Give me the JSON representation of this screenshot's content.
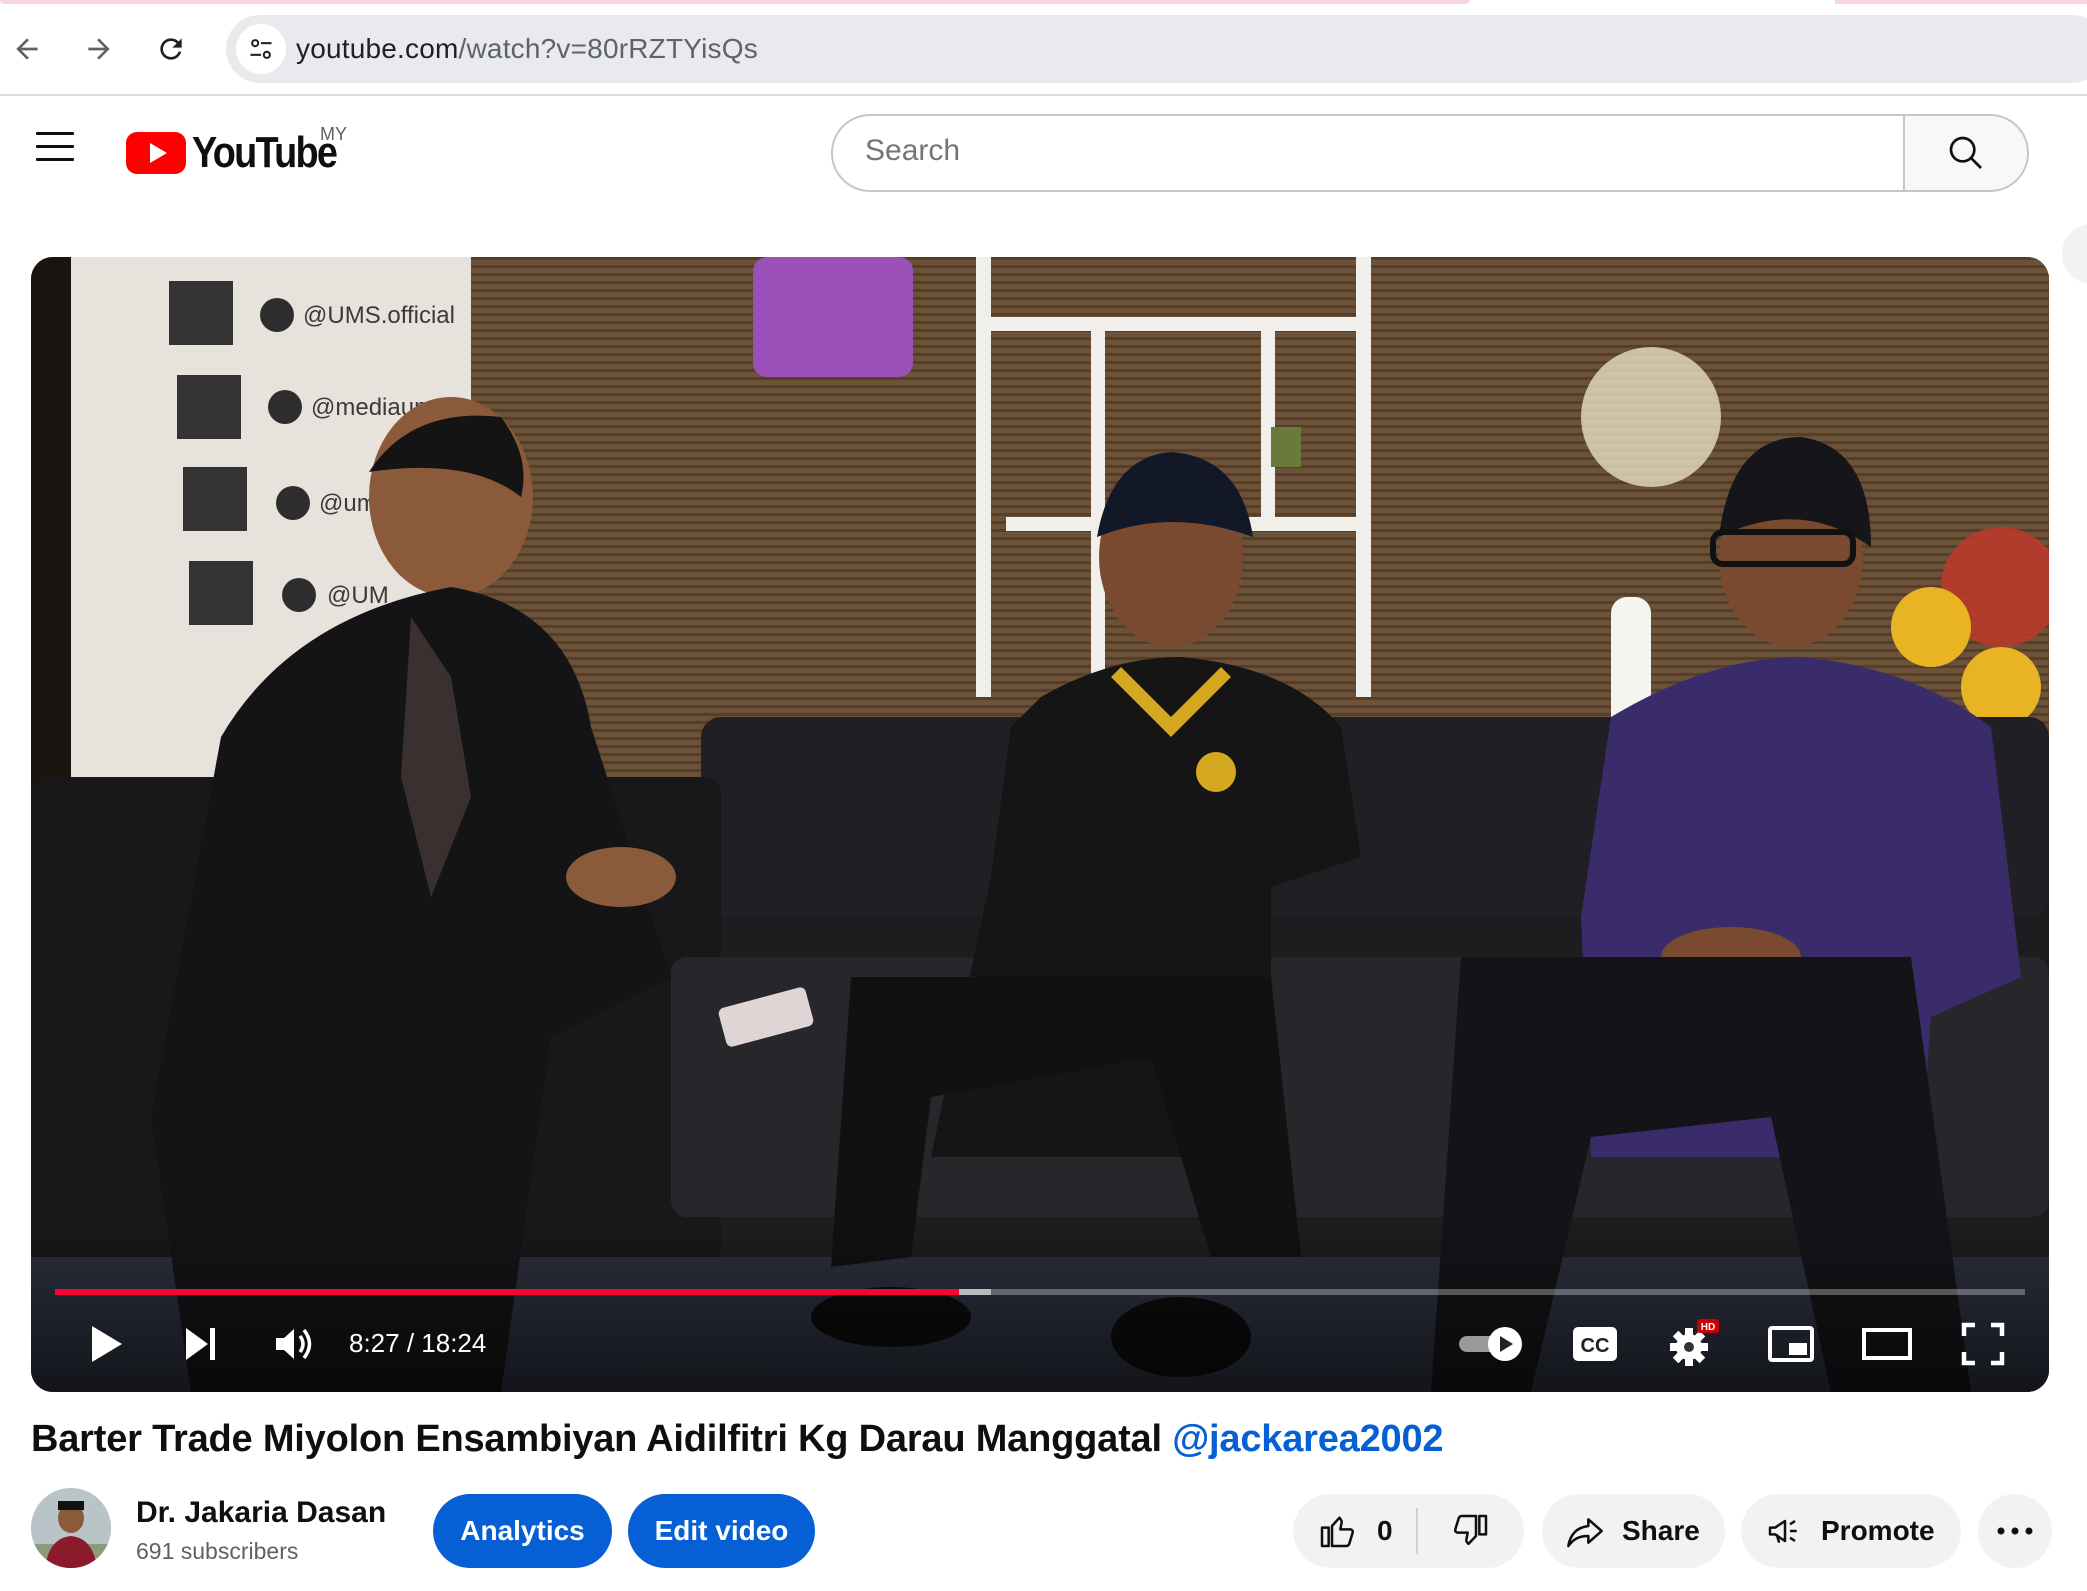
{
  "browser": {
    "url_host": "youtube.com",
    "url_path": "/watch?v=80rRZTYisQs"
  },
  "header": {
    "logo_text": "YouTube",
    "country_code": "MY",
    "search_placeholder": "Search"
  },
  "player": {
    "current_time": "8:27",
    "duration": "18:24",
    "time_display": "8:27 / 18:24",
    "progress_fraction": 0.459,
    "buffered_fraction": 0.475,
    "hd_badge": "HD",
    "cc_label": "CC",
    "scene_text": {
      "social_1": "@UMS.official",
      "social_2": "@mediaums",
      "social_3": "@umsc",
      "social_4": "@UM"
    }
  },
  "video": {
    "title": "Barter Trade Miyolon Ensambiyan Aidilfitri Kg Darau Manggatal ",
    "title_mention": "@jackarea2002"
  },
  "channel": {
    "name": "Dr. Jakaria Dasan",
    "subscribers": "691 subscribers"
  },
  "actions": {
    "analytics_label": "Analytics",
    "edit_label": "Edit video",
    "like_count": "0",
    "share_label": "Share",
    "promote_label": "Promote"
  },
  "colors": {
    "youtube_red": "#ff0000",
    "progress_red": "#ff0033",
    "primary_blue": "#065fd4",
    "chip_gray": "#f2f2f2"
  }
}
